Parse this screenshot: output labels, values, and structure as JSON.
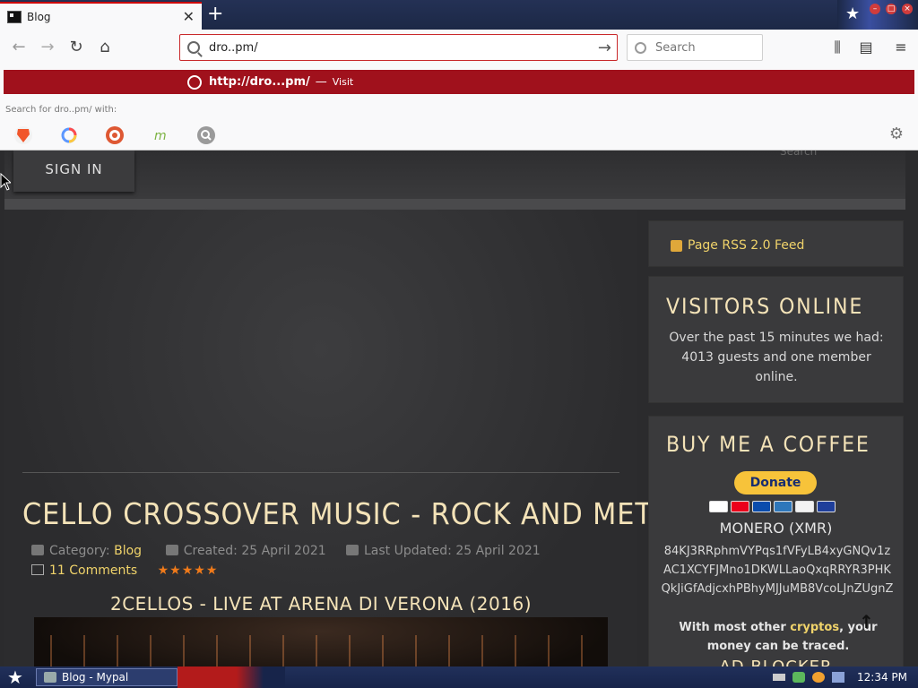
{
  "browser": {
    "tab_title": "Blog",
    "url": "dro..pm/",
    "search_placeholder": "Search",
    "dropdown": {
      "visit_url": "http://dro...pm/",
      "visit_sep": "—",
      "visit_label": "Visit",
      "search_for": "Search for dro..pm/ with:"
    },
    "engines": [
      "brave-icon",
      "qwant-icon",
      "duckduckgo-icon",
      "mojeek-icon",
      "search-engine-icon"
    ],
    "accent_color": "#a0111c"
  },
  "site": {
    "signin_label": "SIGN IN",
    "search_ghost": "Search",
    "article": {
      "title": "CELLO CROSSOVER MUSIC - ROCK AND METAL",
      "category_label": "Category:",
      "category_value": "Blog",
      "created": "Created: 25 April 2021",
      "updated": "Last Updated: 25 April 2021",
      "comments": "11 Comments",
      "rating": "★★★★★",
      "subtitle": "2CELLOS - LIVE AT ARENA DI VERONA (2016)"
    },
    "sidebar": {
      "rss_label": "Page RSS 2.0 Feed",
      "visitors_title": "VISITORS ONLINE",
      "visitors_text": "Over the past 15 minutes we had: 4013 guests and one member online.",
      "coffee_title": "BUY ME A COFFEE",
      "donate_label": "Donate",
      "monero_label": "MONERO (XMR)",
      "monero_address": "84KJ3RRphmVYPqs1fVFyLB4xyGNQv1zAC1XCYFJMno1DKWLLaoQxqRRYR3PHKQkJiGfAdjcxhPBhyMJJuMB8VcoLJnZUgnZ",
      "privacy_pre": "With most other ",
      "privacy_highlight": "cryptos",
      "privacy_post": ", your money can be traced.",
      "adblocker_title": "AD BLOCKER"
    }
  },
  "taskbar": {
    "task_label": "Blog - Mypal",
    "clock": "12:34 PM"
  }
}
